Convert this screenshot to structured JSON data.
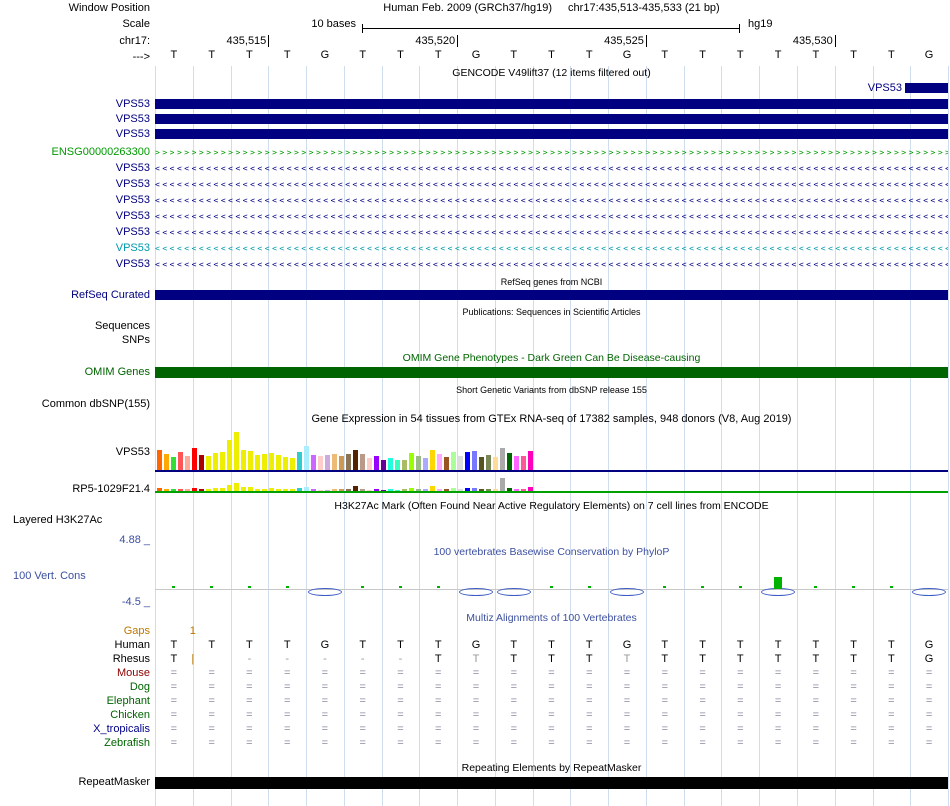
{
  "colors": {
    "navy": "#000080",
    "teal": "#0099AA",
    "green": "#009900",
    "dkgreen": "#006400",
    "blue": "#3C50A0",
    "orange": "#BB7700",
    "maroon": "#8B0000",
    "gridline": "#CFDDED"
  },
  "header": {
    "window_position_label": "Window Position",
    "scale_row_label": "Scale",
    "chrom_label": "chr17:",
    "strand_label": "--->",
    "title_assembly": "Human Feb. 2009 (GRCh37/hg19)",
    "title_position": "chr17:435,513-435,533 (21 bp)",
    "scale_text": "10 bases",
    "assembly": "hg19",
    "ticks": [
      {
        "label": "435,515",
        "col": 3
      },
      {
        "label": "435,520",
        "col": 8
      },
      {
        "label": "435,525",
        "col": 13
      },
      {
        "label": "435,530",
        "col": 18
      }
    ]
  },
  "sequence": {
    "bases": [
      "T",
      "T",
      "T",
      "T",
      "G",
      "T",
      "T",
      "T",
      "G",
      "T",
      "T",
      "T",
      "G",
      "T",
      "T",
      "T",
      "T",
      "T",
      "T",
      "T",
      "G"
    ]
  },
  "gencode": {
    "header": "GENCODE V49lift37 (12 items filtered out)",
    "right_item_label": "VPS53",
    "bar_rows": [
      {
        "label": "VPS53"
      },
      {
        "label": "VPS53"
      },
      {
        "label": "VPS53"
      }
    ],
    "arrow_rows": [
      {
        "label": "ENSG00000263300",
        "color": "#009900",
        "dir": "right"
      },
      {
        "label": "VPS53",
        "color": "#000080",
        "dir": "left"
      },
      {
        "label": "VPS53",
        "color": "#000080",
        "dir": "left"
      },
      {
        "label": "VPS53",
        "color": "#000080",
        "dir": "left"
      },
      {
        "label": "VPS53",
        "color": "#000080",
        "dir": "left"
      },
      {
        "label": "VPS53",
        "color": "#000080",
        "dir": "left"
      },
      {
        "label": "VPS53",
        "color": "#0099AA",
        "dir": "left"
      },
      {
        "label": "VPS53",
        "color": "#000080",
        "dir": "left"
      }
    ]
  },
  "refseq": {
    "header": "RefSeq genes from NCBI",
    "track_label": "RefSeq Curated"
  },
  "publications": {
    "header": "Publications: Sequences in Scientific Articles",
    "sequences_label": "Sequences",
    "snps_label": "SNPs"
  },
  "omim": {
    "header": "OMIM Gene Phenotypes - Dark Green Can Be Disease-causing",
    "track_label": "OMIM Genes"
  },
  "dbsnp": {
    "header": "Short Genetic Variants from dbSNP release 155",
    "track_label": "Common dbSNP(155)"
  },
  "gtex": {
    "header": "Gene Expression in 54 tissues from GTEx RNA-seq of 17382 samples, 948 donors (V8, Aug 2019)",
    "vps53_label": "VPS53",
    "rp5_label": "RP5-1029F21.4",
    "colors": [
      "#FF6600",
      "#FFAA00",
      "#33DD33",
      "#FF5555",
      "#FFAA99",
      "#FF0000",
      "#AA0000",
      "#EEEE00",
      "#EEEE00",
      "#EEEE00",
      "#EEEE00",
      "#EEEE00",
      "#EEEE00",
      "#EEEE00",
      "#EEEE00",
      "#EEEE00",
      "#EEEE00",
      "#EEEE00",
      "#EEEE00",
      "#EEEE00",
      "#33CCCC",
      "#AAEEFF",
      "#CC66FF",
      "#FFCCCC",
      "#CCAADD",
      "#EEBB77",
      "#CC9955",
      "#8B7355",
      "#552200",
      "#BB9988",
      "#FFCCCC",
      "#9900FF",
      "#660099",
      "#22FFDD",
      "#33FFC0",
      "#AABB66",
      "#99FF00",
      "#99BB88",
      "#AAAAFF",
      "#FFD700",
      "#FFAAFF",
      "#995522",
      "#AAFF99",
      "#DDDDDD",
      "#0000FF",
      "#7777FF",
      "#555522",
      "#778855",
      "#FFDD99",
      "#AAAAAA",
      "#006600",
      "#FF66FF",
      "#FF5599",
      "#FF00BB"
    ],
    "vps53_heights": [
      20,
      16,
      13,
      18,
      14,
      22,
      15,
      14,
      17,
      18,
      30,
      38,
      20,
      19,
      15,
      16,
      17,
      15,
      13,
      12,
      18,
      24,
      15,
      14,
      15,
      16,
      14,
      16,
      20,
      16,
      12,
      14,
      10,
      12,
      10,
      10,
      17,
      14,
      12,
      20,
      16,
      13,
      18,
      14,
      18,
      19,
      13,
      15,
      13,
      22,
      17,
      14,
      14,
      19
    ],
    "rp5_heights": [
      3,
      2,
      2,
      2,
      2,
      3,
      2,
      2,
      3,
      3,
      6,
      8,
      4,
      4,
      2,
      2,
      3,
      2,
      2,
      2,
      3,
      4,
      2,
      1,
      1,
      2,
      2,
      2,
      5,
      2,
      1,
      2,
      1,
      2,
      1,
      2,
      3,
      2,
      2,
      5,
      2,
      2,
      3,
      2,
      3,
      3,
      2,
      2,
      2,
      13,
      3,
      2,
      2,
      4
    ]
  },
  "encode": {
    "header": "H3K27Ac Mark (Often Found Near Active Regulatory Elements) on 7 cell lines from ENCODE",
    "track_label": "Layered H3K27Ac"
  },
  "conservation": {
    "header": "100 vertebrates Basewise Conservation by PhyloP",
    "track_label": "100 Vert. Cons",
    "max_label": "4.88 _",
    "min_label": "-4.5 _",
    "lens_cols": [
      4,
      8,
      9,
      12,
      16,
      20
    ],
    "peak_col": 16
  },
  "multiz": {
    "header": "Multiz Alignments of 100 Vertebrates",
    "rows": [
      {
        "label": "Gaps",
        "color": "#BB7700",
        "insert_text": "1",
        "insert_col": 1
      },
      {
        "label": "Human",
        "color": "#000000",
        "letters": [
          "T",
          "T",
          "T",
          "T",
          "G",
          "T",
          "T",
          "T",
          "G",
          "T",
          "T",
          "T",
          "G",
          "T",
          "T",
          "T",
          "T",
          "T",
          "T",
          "T",
          "G"
        ]
      },
      {
        "label": "Rhesus",
        "color": "#000000",
        "letters": [
          "T",
          "",
          "-",
          "-",
          "-",
          "-",
          "-",
          "T",
          "T",
          "T",
          "T",
          "T",
          "T",
          "T",
          "T",
          "T",
          "T",
          "T",
          "T",
          "T",
          "G"
        ],
        "dim_cols": [
          2,
          3,
          4,
          5,
          6,
          8,
          12
        ],
        "insert_text": "|",
        "insert_col": 1
      },
      {
        "label": "Mouse",
        "color": "#8B0000",
        "fill": "="
      },
      {
        "label": "Dog",
        "color": "#006400",
        "fill": "="
      },
      {
        "label": "Elephant",
        "color": "#006400",
        "fill": "="
      },
      {
        "label": "Chicken",
        "color": "#006400",
        "fill": "="
      },
      {
        "label": "X_tropicalis",
        "color": "#000088",
        "fill": "="
      },
      {
        "label": "Zebrafish",
        "color": "#006400",
        "fill": "="
      }
    ]
  },
  "repeat": {
    "header": "Repeating Elements by RepeatMasker",
    "track_label": "RepeatMasker"
  }
}
